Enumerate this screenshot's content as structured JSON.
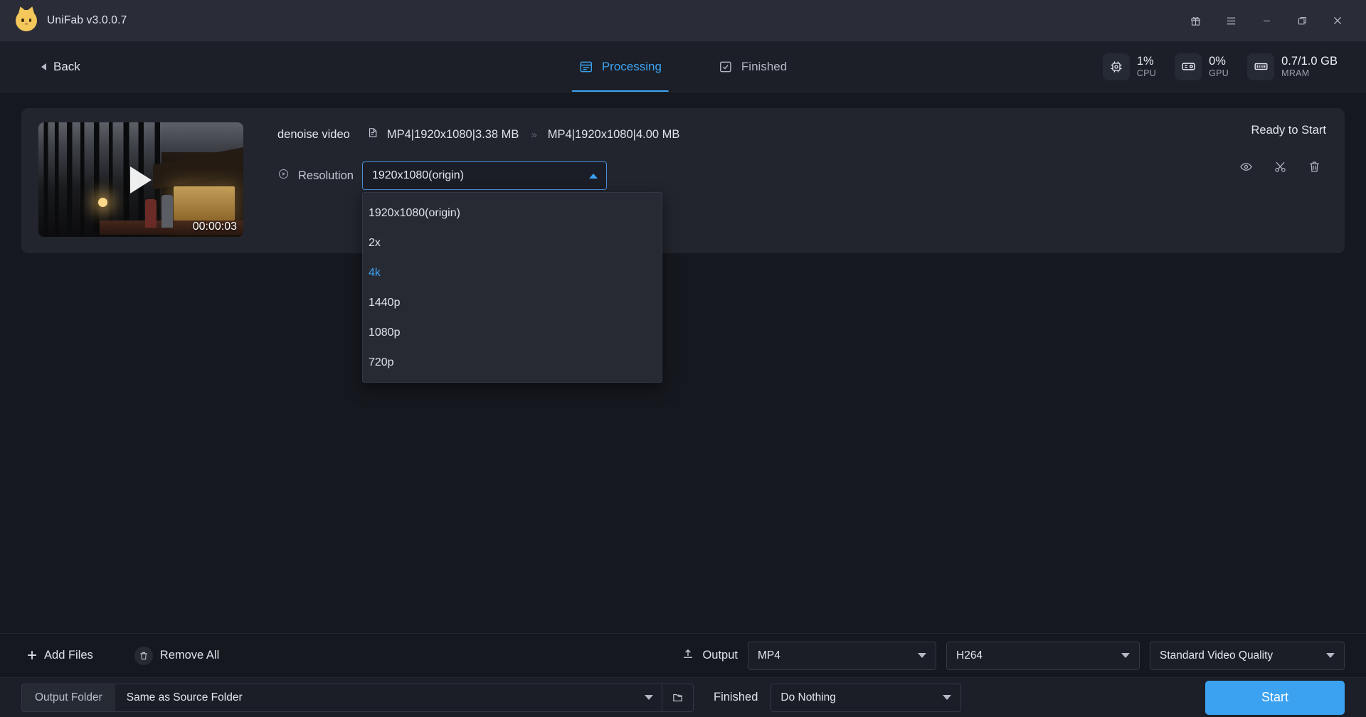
{
  "titlebar": {
    "app_title": "UniFab v3.0.0.7",
    "logo_icon": "cat-logo-icon",
    "buttons": [
      {
        "name": "gift-icon",
        "glyph": "gift"
      },
      {
        "name": "menu-icon",
        "glyph": "hamburger"
      },
      {
        "name": "minimize-icon",
        "glyph": "minimize"
      },
      {
        "name": "maximize-icon",
        "glyph": "restore"
      },
      {
        "name": "close-icon",
        "glyph": "close"
      }
    ]
  },
  "header": {
    "back_label": "Back",
    "tabs": [
      {
        "label": "Processing",
        "active": true,
        "icon": "processing-icon"
      },
      {
        "label": "Finished",
        "active": false,
        "icon": "finished-icon"
      }
    ],
    "stats": [
      {
        "value": "1%",
        "label": "CPU",
        "icon": "cpu-icon"
      },
      {
        "value": "0%",
        "label": "GPU",
        "icon": "gpu-icon"
      },
      {
        "value": "0.7/1.0 GB",
        "label": "MRAM",
        "icon": "ram-icon"
      }
    ]
  },
  "task": {
    "thumbnail_duration": "00:00:03",
    "name": "denoise video",
    "source_format": "MP4|1920x1080|3.38 MB",
    "target_format": "MP4|1920x1080|4.00 MB",
    "arrow_glyph": "»",
    "resolution_label": "Resolution",
    "resolution_value": "1920x1080(origin)",
    "resolution_options": [
      {
        "label": "1920x1080(origin)",
        "selected": false
      },
      {
        "label": "2x",
        "selected": false
      },
      {
        "label": "4k",
        "selected": true
      },
      {
        "label": "1440p",
        "selected": false
      },
      {
        "label": "1080p",
        "selected": false
      },
      {
        "label": "720p",
        "selected": false
      }
    ],
    "status": "Ready to Start",
    "actions": [
      {
        "name": "preview-icon"
      },
      {
        "name": "trim-icon"
      },
      {
        "name": "delete-icon"
      }
    ]
  },
  "toolbar": {
    "add_files_label": "Add Files",
    "remove_all_label": "Remove All",
    "output_label": "Output",
    "container_value": "MP4",
    "codec_value": "H264",
    "quality_value": "Standard Video Quality"
  },
  "footer": {
    "output_folder_label": "Output Folder",
    "output_folder_value": "Same as Source Folder",
    "finished_label": "Finished",
    "finished_action_value": "Do Nothing",
    "start_label": "Start"
  },
  "colors": {
    "accent": "#3ba2f2",
    "window_bg": "#16181f",
    "titlebar_bg": "#2a2d38",
    "card_bg": "#22252e"
  }
}
